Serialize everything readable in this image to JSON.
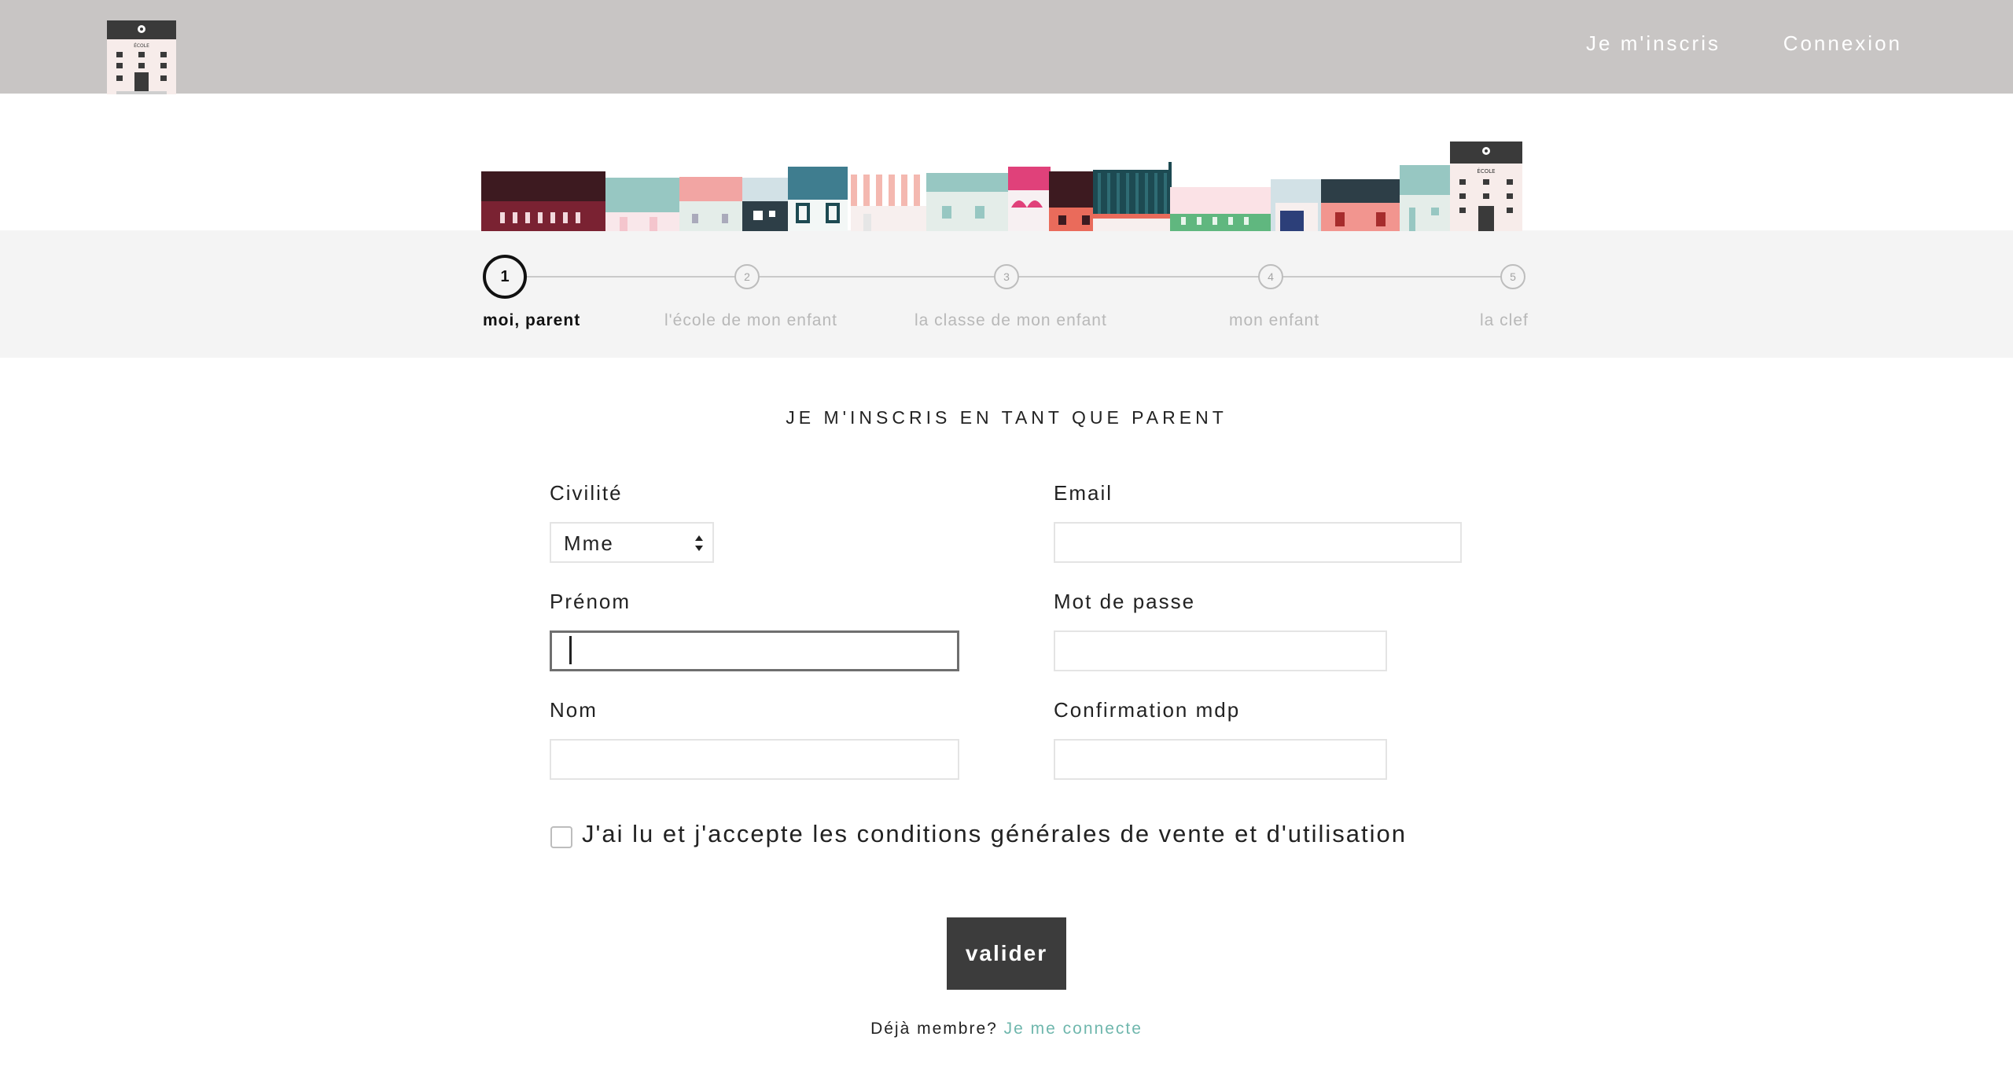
{
  "header": {
    "logo_icon": "school-building-icon",
    "logo_sign_text": "ÉCOLE",
    "nav": {
      "signup_label": "Je m'inscris",
      "login_label": "Connexion"
    },
    "background_color": "#c8c5c4"
  },
  "skyline": {
    "icon": "village-skyline-illustration",
    "school_sign_text": "ÉCOLE"
  },
  "stepper": {
    "current_step": 1,
    "steps": [
      {
        "number": "1",
        "label": "moi, parent"
      },
      {
        "number": "2",
        "label": "l'école de mon enfant"
      },
      {
        "number": "3",
        "label": "la classe de mon enfant"
      },
      {
        "number": "4",
        "label": "mon enfant"
      },
      {
        "number": "5",
        "label": "la clef"
      }
    ]
  },
  "form": {
    "title": "JE M'INSCRIS EN TANT QUE PARENT",
    "civilite": {
      "label": "Civilité",
      "value": "Mme"
    },
    "prenom": {
      "label": "Prénom",
      "value": ""
    },
    "nom": {
      "label": "Nom",
      "value": ""
    },
    "email": {
      "label": "Email",
      "value": ""
    },
    "password": {
      "label": "Mot de passe",
      "value": ""
    },
    "password_confirm": {
      "label": "Confirmation mdp",
      "value": ""
    },
    "terms": {
      "label": "J'ai lu et j'accepte les conditions générales de vente et d'utilisation",
      "checked": false
    },
    "submit_label": "valider"
  },
  "footer": {
    "already_member": "Déjà membre?",
    "login_link": "Je me connecte"
  },
  "colors": {
    "accent_teal": "#6fb7ad",
    "button_dark": "#3c3c3c",
    "band_gray": "#f4f4f4"
  }
}
